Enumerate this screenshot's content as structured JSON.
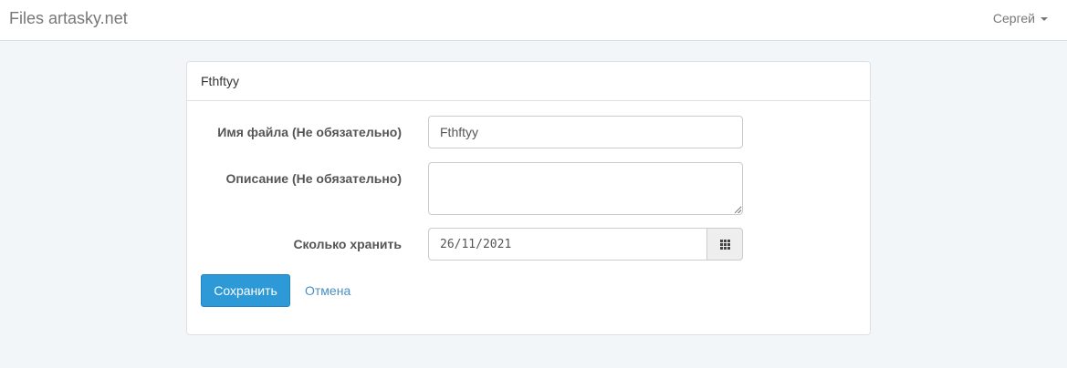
{
  "navbar": {
    "brand": "Files artasky.net",
    "user": "Сергей"
  },
  "panel": {
    "title": "Fthftyy"
  },
  "form": {
    "file_name_label": "Имя файла (Не обязательно)",
    "file_name_value": "Fthftyy",
    "description_label": "Описание (Не обязательно)",
    "description_value": "",
    "storage_label": "Сколько хранить",
    "storage_value": "26/11/2021"
  },
  "actions": {
    "save_label": "Сохранить",
    "cancel_label": "Отмена"
  },
  "icons": {
    "user_caret": "caret-down-icon",
    "date_picker": "calendar-grid-icon",
    "textarea_resize": "resize-grip-icon"
  },
  "colors": {
    "page_bg": "#f3f6f9",
    "primary": "#2d9ad7",
    "link": "#4b8fc0"
  }
}
